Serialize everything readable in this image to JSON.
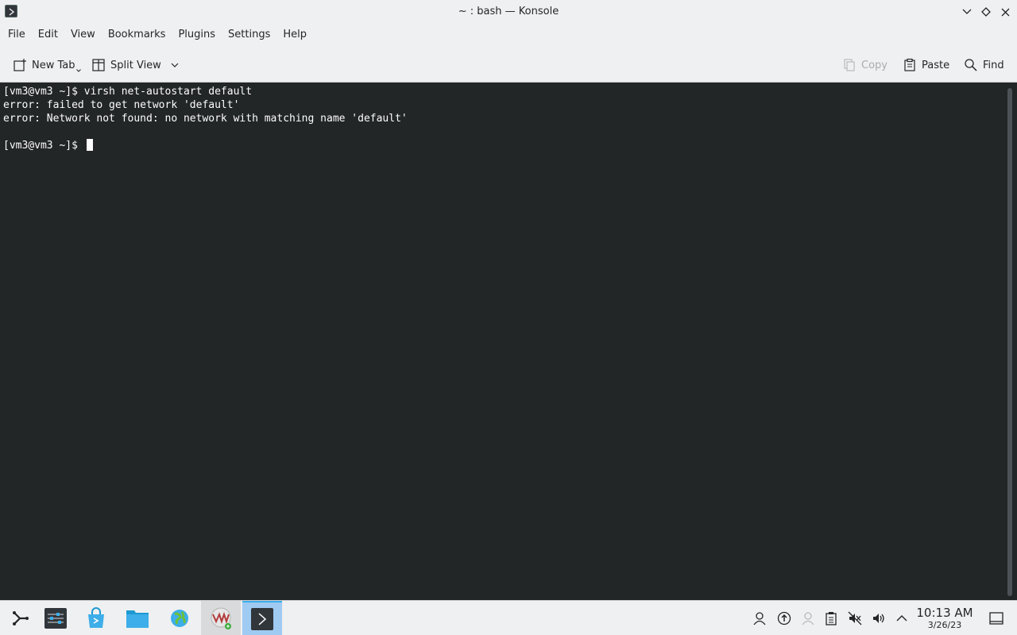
{
  "window": {
    "title": "~ : bash — Konsole"
  },
  "menubar": {
    "items": [
      "File",
      "Edit",
      "View",
      "Bookmarks",
      "Plugins",
      "Settings",
      "Help"
    ]
  },
  "toolbar": {
    "new_tab": "New Tab",
    "split_view": "Split View",
    "copy": "Copy",
    "paste": "Paste",
    "find": "Find"
  },
  "terminal": {
    "lines": [
      "[vm3@vm3 ~]$ virsh net-autostart default",
      "error: failed to get network 'default'",
      "error: Network not found: no network with matching name 'default'",
      "",
      "[vm3@vm3 ~]$ "
    ]
  },
  "taskbar": {
    "apps": [
      {
        "name": "application-launcher-icon"
      },
      {
        "name": "system-settings-icon"
      },
      {
        "name": "discover-store-icon"
      },
      {
        "name": "dolphin-file-manager-icon"
      },
      {
        "name": "web-browser-icon"
      },
      {
        "name": "virt-manager-icon"
      },
      {
        "name": "konsole-terminal-icon"
      }
    ],
    "clock_time": "10:13 AM",
    "clock_date": "3/26/23"
  },
  "colors": {
    "terminal_bg": "#232627",
    "terminal_fg": "#fcfcfc",
    "chrome_bg": "#eff0f1",
    "active_task": "#9fcaf2",
    "accent": "#3daee9"
  }
}
